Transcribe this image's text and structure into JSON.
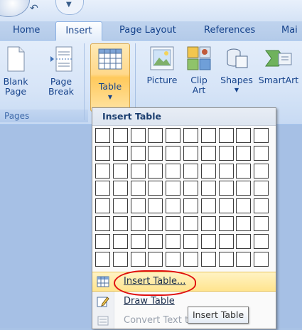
{
  "tabs": [
    "Home",
    "Insert",
    "Page Layout",
    "References",
    "Mai"
  ],
  "ribbon": {
    "blank_page": [
      "Blank",
      "Page"
    ],
    "page_break": [
      "Page",
      "Break"
    ],
    "table": "Table",
    "picture": "Picture",
    "clip_art": [
      "Clip",
      "Art"
    ],
    "shapes": "Shapes",
    "smartart": "SmartArt",
    "pages_group": "Pages"
  },
  "dropdown": {
    "title": "Insert Table",
    "grid_cols": 10,
    "grid_rows": 8,
    "items": [
      {
        "label": "Insert Table...",
        "icon": "table-icon",
        "highlighted": true
      },
      {
        "label": "Draw Table",
        "icon": "pencil-icon"
      },
      {
        "label": "Convert Text to Table...",
        "icon": "convert-icon",
        "disabled": true
      }
    ]
  },
  "tooltip": "Insert Table",
  "colors": {
    "annotation": "#e01010",
    "hover": "#ffe48e"
  }
}
